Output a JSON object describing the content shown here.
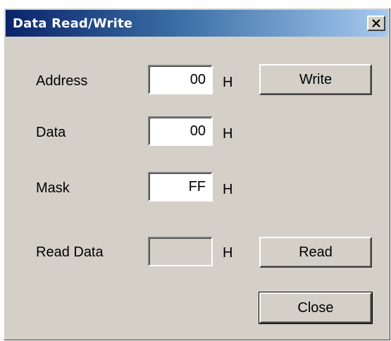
{
  "window": {
    "title": "Data Read/Write",
    "close_label": "Close window"
  },
  "fields": {
    "address": {
      "label": "Address",
      "value": "00",
      "unit": "H"
    },
    "data": {
      "label": "Data",
      "value": "00",
      "unit": "H"
    },
    "mask": {
      "label": "Mask",
      "value": "FF",
      "unit": "H"
    },
    "read_data": {
      "label": "Read Data",
      "value": "",
      "unit": "H"
    }
  },
  "buttons": {
    "write": "Write",
    "read": "Read",
    "close": "Close"
  },
  "colors": {
    "face": "#d4d0c8",
    "title_start": "#0a246a",
    "title_end": "#a6caf0"
  },
  "icons": {
    "close": "close-icon"
  }
}
